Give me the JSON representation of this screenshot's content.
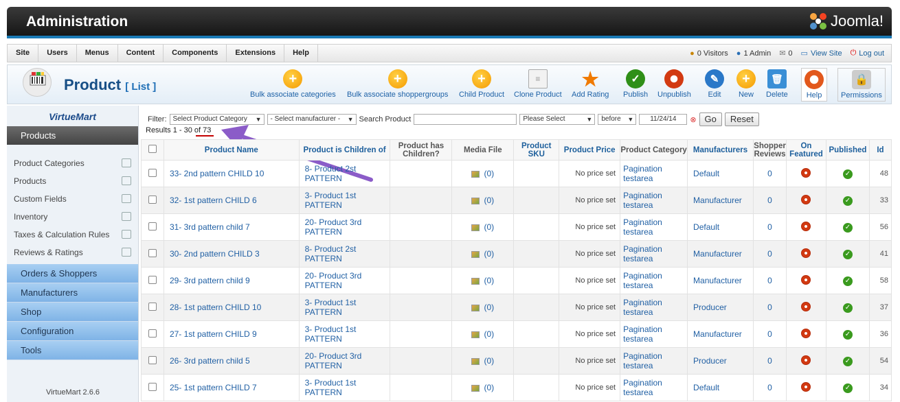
{
  "app": {
    "title": "Administration",
    "logo_text": "Joomla!"
  },
  "menu": [
    "Site",
    "Users",
    "Menus",
    "Content",
    "Components",
    "Extensions",
    "Help"
  ],
  "status": {
    "visitors": "0 Visitors",
    "admin": "1 Admin",
    "messages": "0",
    "view_site": "View Site",
    "logout": "Log out"
  },
  "page": {
    "title": "Product",
    "subtitle": "[ List ]"
  },
  "toolbar": [
    {
      "label": "Bulk associate categories",
      "icon": "plus-icon"
    },
    {
      "label": "Bulk associate shoppergroups",
      "icon": "plus-icon"
    },
    {
      "label": "Child Product",
      "icon": "plus-icon"
    },
    {
      "label": "Clone Product",
      "icon": "copy-icon"
    },
    {
      "label": "Add Rating",
      "icon": "star-icon"
    },
    {
      "label": "Publish",
      "icon": "check-icon"
    },
    {
      "label": "Unpublish",
      "icon": "unpublish-icon"
    },
    {
      "label": "Edit",
      "icon": "pencil-icon"
    },
    {
      "label": "New",
      "icon": "plus-icon"
    },
    {
      "label": "Delete",
      "icon": "trash-icon"
    },
    {
      "label": "Help",
      "icon": "lifebuoy-icon"
    },
    {
      "label": "Permissions",
      "icon": "lock-icon"
    }
  ],
  "sidebar": {
    "logo": "VirtueMart",
    "active_section": "Products",
    "items": [
      "Product Categories",
      "Products",
      "Custom Fields",
      "Inventory",
      "Taxes & Calculation Rules",
      "Reviews & Ratings"
    ],
    "sections": [
      "Orders & Shoppers",
      "Manufacturers",
      "Shop",
      "Configuration",
      "Tools"
    ],
    "version": "VirtueMart 2.6.6"
  },
  "filter": {
    "label": "Filter:",
    "category": "Select Product Category",
    "manufacturer": "- Select manufacturer -",
    "search_label": "Search Product",
    "search_value": "",
    "date_select": "Please Select",
    "before": "before",
    "date": "11/24/14",
    "go": "Go",
    "reset": "Reset"
  },
  "results": "Results 1 - 30 of 73",
  "colors": {
    "accent": "#1d5f9c",
    "sidebar_section": "#8dbde9",
    "unpublish": "#d23a12",
    "publish": "#3a9a1e"
  },
  "table": {
    "headers": [
      "Product Name",
      "Product is Children of",
      "Product has Children?",
      "Media File",
      "Product SKU",
      "Product Price",
      "Product Category",
      "Manufacturers",
      "Shopper Reviews",
      "On Featured",
      "Published",
      "Id"
    ],
    "rows": [
      {
        "name": "33- 2nd pattern CHILD 10",
        "parent": "8- Product 2st PATTERN",
        "media": "(0)",
        "price": "No price set",
        "category": "Pagination testarea",
        "manufacturer": "Default",
        "reviews": "0",
        "id": "48"
      },
      {
        "name": "32- 1st pattern CHILD 6",
        "parent": "3- Product 1st PATTERN",
        "media": "(0)",
        "price": "No price set",
        "category": "Pagination testarea",
        "manufacturer": "Manufacturer",
        "reviews": "0",
        "id": "33"
      },
      {
        "name": "31- 3rd pattern child 7",
        "parent": "20- Product 3rd PATTERN",
        "media": "(0)",
        "price": "No price set",
        "category": "Pagination testarea",
        "manufacturer": "Default",
        "reviews": "0",
        "id": "56"
      },
      {
        "name": "30- 2nd pattern CHILD 3",
        "parent": "8- Product 2st PATTERN",
        "media": "(0)",
        "price": "No price set",
        "category": "Pagination testarea",
        "manufacturer": "Manufacturer",
        "reviews": "0",
        "id": "41"
      },
      {
        "name": "29- 3rd pattern child 9",
        "parent": "20- Product 3rd PATTERN",
        "media": "(0)",
        "price": "No price set",
        "category": "Pagination testarea",
        "manufacturer": "Manufacturer",
        "reviews": "0",
        "id": "58"
      },
      {
        "name": "28- 1st pattern CHILD 10",
        "parent": "3- Product 1st PATTERN",
        "media": "(0)",
        "price": "No price set",
        "category": "Pagination testarea",
        "manufacturer": "Producer",
        "reviews": "0",
        "id": "37"
      },
      {
        "name": "27- 1st pattern CHILD 9",
        "parent": "3- Product 1st PATTERN",
        "media": "(0)",
        "price": "No price set",
        "category": "Pagination testarea",
        "manufacturer": "Manufacturer",
        "reviews": "0",
        "id": "36"
      },
      {
        "name": "26- 3rd pattern child 5",
        "parent": "20- Product 3rd PATTERN",
        "media": "(0)",
        "price": "No price set",
        "category": "Pagination testarea",
        "manufacturer": "Producer",
        "reviews": "0",
        "id": "54"
      },
      {
        "name": "25- 1st pattern CHILD 7",
        "parent": "3- Product 1st PATTERN",
        "media": "(0)",
        "price": "No price set",
        "category": "Pagination testarea",
        "manufacturer": "Default",
        "reviews": "0",
        "id": "34"
      }
    ]
  }
}
